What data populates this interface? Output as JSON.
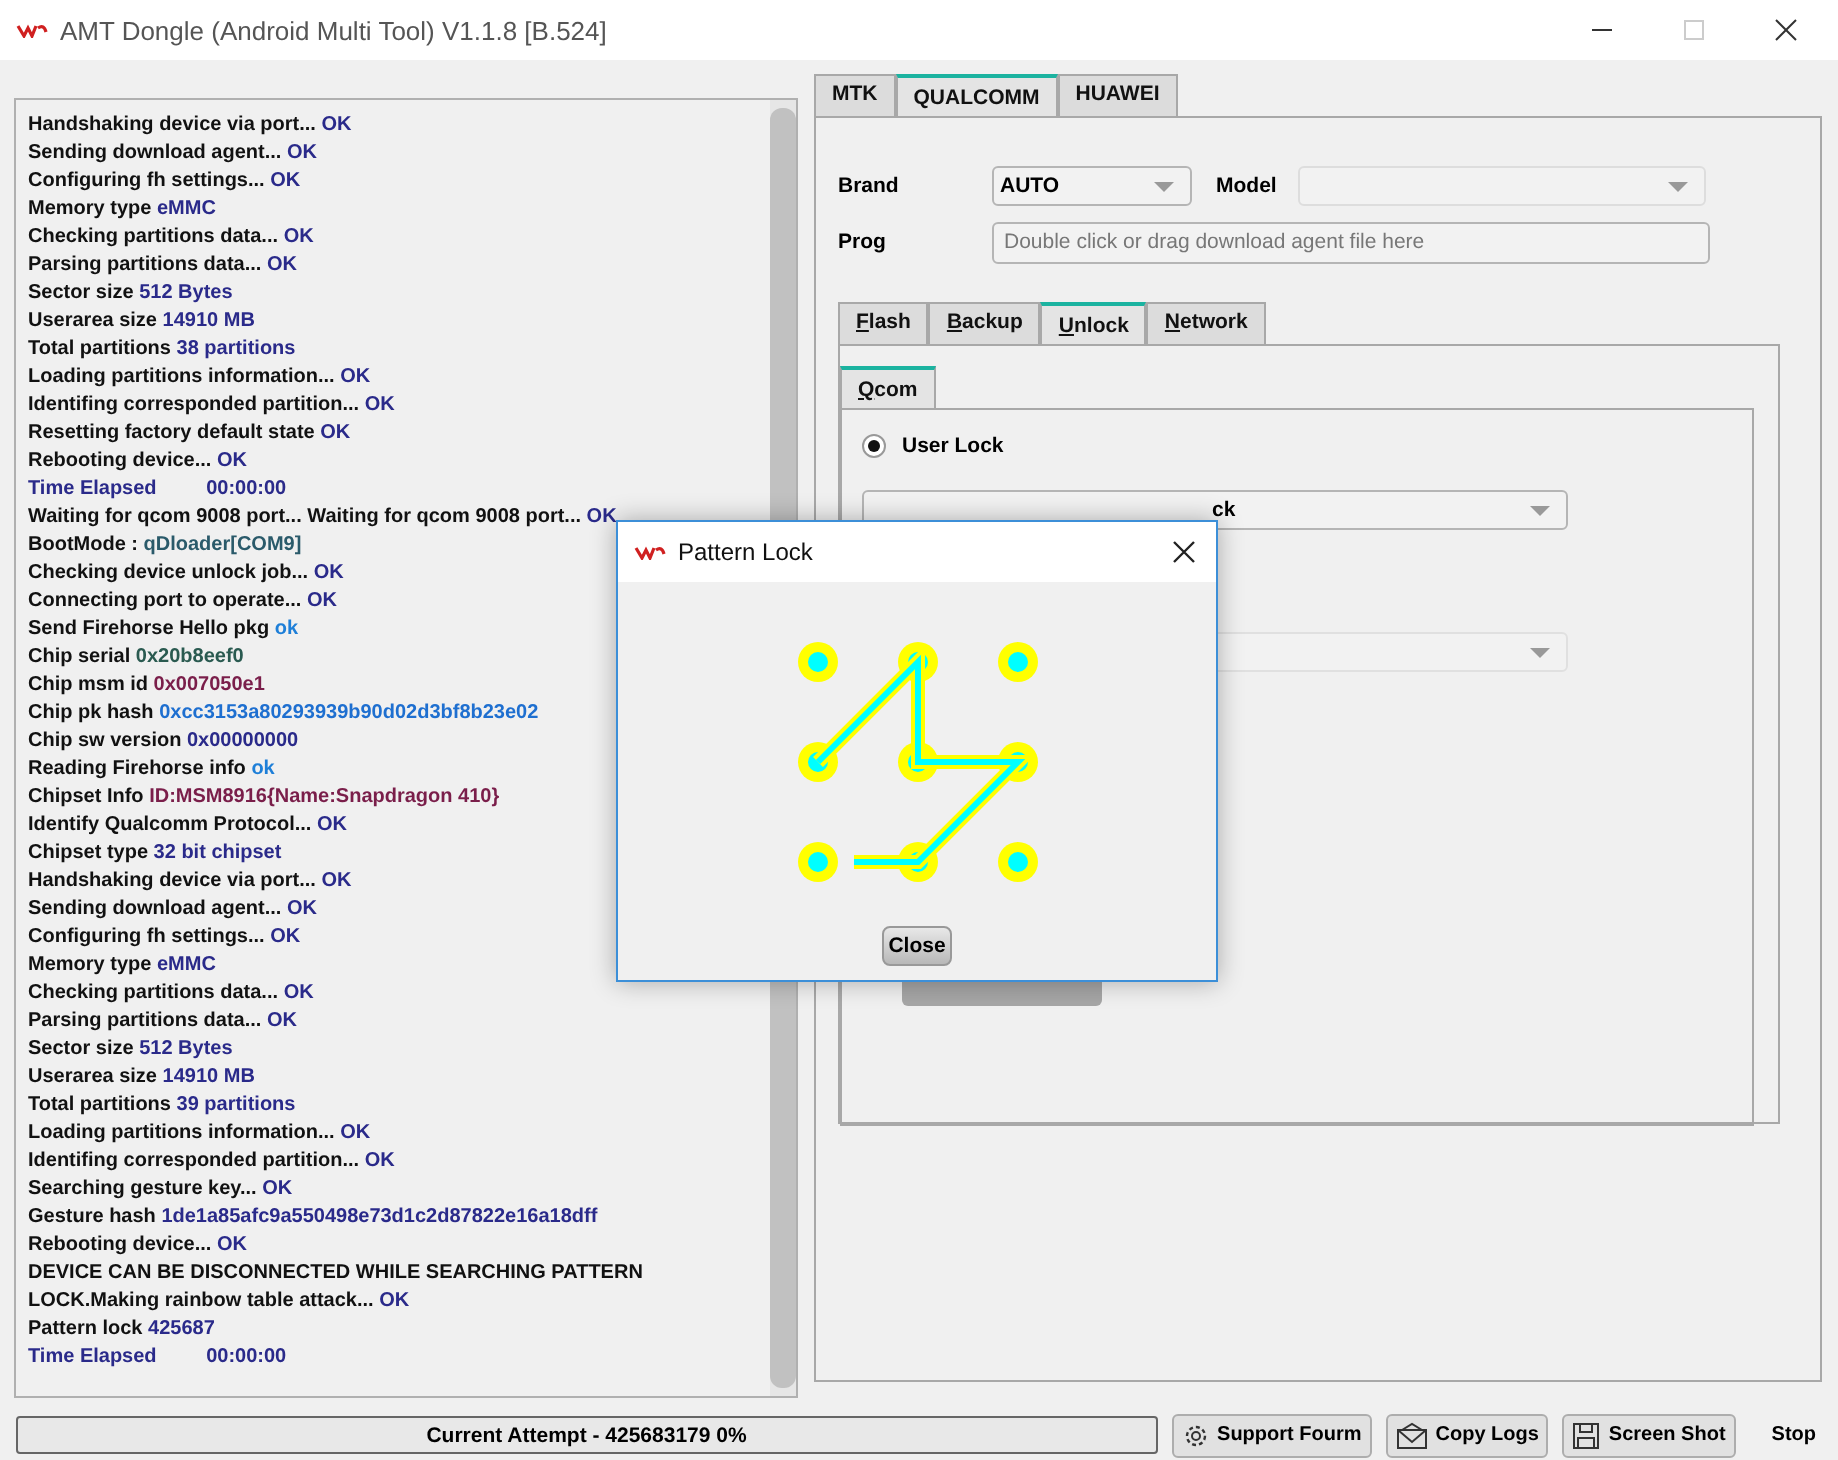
{
  "window": {
    "title": "AMT Dongle (Android Multi Tool) V1.1.8 [B.524]",
    "maximize_disabled": true
  },
  "log": [
    {
      "kind": "step",
      "label": "Handshaking device via port...",
      "value": "OK",
      "color": "#2a2a8a"
    },
    {
      "kind": "step",
      "label": "Sending download agent...",
      "value": "OK",
      "color": "#2a2a8a"
    },
    {
      "kind": "step",
      "label": "Configuring fh settings...",
      "value": "OK",
      "color": "#2a2a8a"
    },
    {
      "kind": "step",
      "label": "Memory type",
      "value": "eMMC",
      "color": "#2a2a8a"
    },
    {
      "kind": "step",
      "label": "Checking partitions data...",
      "value": "OK",
      "color": "#2a2a8a"
    },
    {
      "kind": "step",
      "label": "Parsing partitions data...",
      "value": "OK",
      "color": "#2a2a8a"
    },
    {
      "kind": "step",
      "label": "Sector size",
      "value": "512 Bytes",
      "color": "#2a2a8a"
    },
    {
      "kind": "step",
      "label": "Userarea size",
      "value": "14910 MB",
      "color": "#2a2a8a"
    },
    {
      "kind": "step",
      "label": "Total partitions",
      "value": "38 partitions",
      "color": "#2a2a8a"
    },
    {
      "kind": "step",
      "label": "Loading partitions information...",
      "value": "OK",
      "color": "#2a2a8a"
    },
    {
      "kind": "step",
      "label": "Identifing corresponded partition...",
      "value": "OK",
      "color": "#2a2a8a"
    },
    {
      "kind": "step",
      "label": "Resetting factory default state",
      "value": "OK",
      "color": "#2a2a8a"
    },
    {
      "kind": "step",
      "label": "Rebooting device...",
      "value": "OK",
      "color": "#2a2a8a"
    },
    {
      "kind": "timer",
      "label": "Time Elapsed",
      "value": "00:00:00",
      "color": "#2a2a8a"
    },
    {
      "kind": "step",
      "label": "Waiting for qcom 9008 port... Waiting for qcom 9008 port...",
      "value": "OK",
      "color": "#2a2a8a"
    },
    {
      "kind": "step",
      "label": "BootMode :",
      "value": "qDloader[COM9]",
      "color": "#2a5a6a"
    },
    {
      "kind": "step",
      "label": "Checking device unlock job...",
      "value": "OK",
      "color": "#2a2a8a"
    },
    {
      "kind": "step",
      "label": "Connecting port to operate...",
      "value": "OK",
      "color": "#2a2a8a"
    },
    {
      "kind": "step",
      "label": "Send Firehorse Hello pkg",
      "value": "ok",
      "color": "#1e7fd8"
    },
    {
      "kind": "step",
      "label": "Chip serial",
      "value": "0x20b8eef0",
      "color": "#2a5a50"
    },
    {
      "kind": "step",
      "label": "Chip msm id",
      "value": "0x007050e1",
      "color": "#7a1e4a"
    },
    {
      "kind": "step",
      "label": "Chip pk hash",
      "value": "0xcc3153a80293939b90d02d3bf8b23e02",
      "color": "#1e6fd0"
    },
    {
      "kind": "step",
      "label": "Chip sw version",
      "value": "0x00000000",
      "color": "#2a2a8a"
    },
    {
      "kind": "step",
      "label": "Reading Firehorse info",
      "value": "ok",
      "color": "#1e7fd8"
    },
    {
      "kind": "step",
      "label": "Chipset Info",
      "value": "ID:MSM8916{Name:Snapdragon 410}",
      "color": "#7a1e4a"
    },
    {
      "kind": "step",
      "label": "Identify Qualcomm Protocol...",
      "value": "OK",
      "color": "#2a2a8a"
    },
    {
      "kind": "step",
      "label": "Chipset type",
      "value": "32 bit chipset",
      "color": "#2a2a8a"
    },
    {
      "kind": "step",
      "label": "Handshaking device via port...",
      "value": "OK",
      "color": "#2a2a8a"
    },
    {
      "kind": "step",
      "label": "Sending download agent...",
      "value": "OK",
      "color": "#2a2a8a"
    },
    {
      "kind": "step",
      "label": "Configuring fh settings...",
      "value": "OK",
      "color": "#2a2a8a"
    },
    {
      "kind": "step",
      "label": "Memory type",
      "value": "eMMC",
      "color": "#2a2a8a"
    },
    {
      "kind": "step",
      "label": "Checking partitions data...",
      "value": "OK",
      "color": "#2a2a8a"
    },
    {
      "kind": "step",
      "label": "Parsing partitions data...",
      "value": "OK",
      "color": "#2a2a8a"
    },
    {
      "kind": "step",
      "label": "Sector size",
      "value": "512 Bytes",
      "color": "#2a2a8a"
    },
    {
      "kind": "step",
      "label": "Userarea size",
      "value": "14910 MB",
      "color": "#2a2a8a"
    },
    {
      "kind": "step",
      "label": "Total partitions",
      "value": "39 partitions",
      "color": "#2a2a8a"
    },
    {
      "kind": "step",
      "label": "Loading partitions information...",
      "value": "OK",
      "color": "#2a2a8a"
    },
    {
      "kind": "step",
      "label": "Identifing corresponded partition...",
      "value": "OK",
      "color": "#2a2a8a"
    },
    {
      "kind": "step",
      "label": "Searching gesture key...",
      "value": "OK",
      "color": "#2a2a8a"
    },
    {
      "kind": "step",
      "label": "Gesture hash",
      "value": "1de1a85afc9a550498e73d1c2d87822e16a18dff",
      "color": "#2a2a8a"
    },
    {
      "kind": "step",
      "label": "Rebooting device...",
      "value": "OK",
      "color": "#2a2a8a"
    },
    {
      "kind": "step",
      "label": "DEVICE CAN BE DISCONNECTED WHILE SEARCHING PATTERN LOCK.Making rainbow table attack...",
      "value": "OK",
      "color": "#2a2a8a"
    },
    {
      "kind": "step",
      "label": "Pattern lock",
      "value": "425687",
      "color": "#2a2a8a"
    },
    {
      "kind": "timer",
      "label": "Time Elapsed",
      "value": "00:00:00",
      "color": "#2a2a8a"
    }
  ],
  "platform_tabs": [
    {
      "label": "MTK",
      "selected": false
    },
    {
      "label": "QUALCOMM",
      "selected": true
    },
    {
      "label": "HUAWEI",
      "selected": false
    }
  ],
  "brand": {
    "label": "Brand",
    "value": "AUTO"
  },
  "model": {
    "label": "Model"
  },
  "prog": {
    "label": "Prog",
    "placeholder": "Double click or drag download agent file here"
  },
  "job_tabs": [
    {
      "label": "Flash",
      "selected": false
    },
    {
      "label": "Backup",
      "selected": false
    },
    {
      "label": "Unlock",
      "selected": true
    },
    {
      "label": "Network",
      "selected": false
    }
  ],
  "unlock_tabs": [
    {
      "label": "Qcom",
      "selected": true
    }
  ],
  "user_lock": {
    "label": "User Lock",
    "checked": true
  },
  "lock_type": {
    "value": "ck"
  },
  "dialog": {
    "title": "Pattern Lock",
    "close_button": "Close"
  },
  "progress": {
    "text": "Current Attempt - 425683179 0%",
    "level": 0
  },
  "buttons": [
    {
      "kind": "gear",
      "label": "Support Fourm"
    },
    {
      "kind": "mail",
      "label": "Copy Logs"
    },
    {
      "kind": "disk",
      "label": "Screen Shot"
    },
    {
      "kind": "plain",
      "label": "Stop"
    }
  ]
}
